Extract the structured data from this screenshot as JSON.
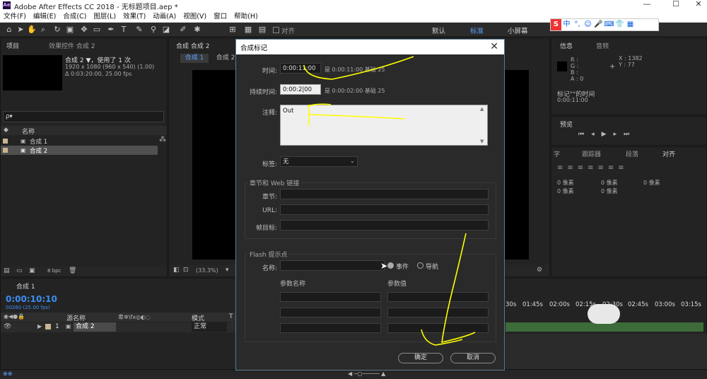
{
  "titlebar": {
    "logo": "Ae",
    "title": "Adobe After Effects CC 2018 - 无标题项目.aep *",
    "minimize": "—",
    "maximize": "☐",
    "close": "✕"
  },
  "menu": [
    "文件(F)",
    "编辑(E)",
    "合成(C)",
    "图层(L)",
    "效果(T)",
    "动画(A)",
    "视图(V)",
    "窗口",
    "帮助(H)"
  ],
  "toolbar": {
    "align_label": "对齐",
    "workspaces": [
      "默认",
      "标准",
      "小屏幕"
    ],
    "active_workspace": "标准"
  },
  "ime": [
    "S",
    "中",
    "°,",
    "☺",
    "🎤",
    "⌨",
    "👕",
    "▦"
  ],
  "project_panel": {
    "tab_project": "项目",
    "tab_effects": "效果控件 合成 2",
    "comp_name": "合成 2 ▼，使用了 1 次",
    "comp_size": "1920 x 1080 (960 x 540) (1.00)",
    "comp_duration": "Δ 0:03:20:00, 25.00 fps",
    "search_placeholder": "ρ▾",
    "col_name": "名称",
    "items": [
      "合成 1",
      "合成 2"
    ],
    "bpc": "8 bpc"
  },
  "comp_panel": {
    "tab_header": "合成 合成 2",
    "tabs": [
      "合成 1",
      "合成 2"
    ],
    "zoom": "(33.3%)"
  },
  "info_panel": {
    "tab_info": "信息",
    "tab_audio": "音频",
    "rgb": [
      "R :",
      "G :",
      "B :",
      "A : 0"
    ],
    "x": "X : 1382",
    "y": "Y : 77",
    "marker_name": "标记\"\"的时间",
    "marker_time": "0:00:11:00"
  },
  "preview_panel": {
    "title": "预览"
  },
  "char_panel": {
    "tabs": [
      "字",
      "跟踪器",
      "段落",
      "对齐"
    ],
    "values": [
      "0 像素",
      "0 像素",
      "0 像素",
      "0 像素",
      "0 像素"
    ]
  },
  "timeline": {
    "tab": "合成 1",
    "timecode": "0:00:10:10",
    "timecode_sub": "00260 (25.00 fps)",
    "col_source": "源名称",
    "col_mode": "模式",
    "col_t": "T",
    "layer_index": "1",
    "layer_name": "合成 2",
    "layer_mode": "正常",
    "ruler": [
      "30s",
      "01:45s",
      "02:00s",
      "02:15s",
      "02:30s",
      "02:45s",
      "03:00s",
      "03:15s"
    ]
  },
  "dialog": {
    "title": "合成标记",
    "close": "✕",
    "time_label": "时间:",
    "time_value": "0:00:11:00",
    "time_note": "是 0:00:11:00 基础 25",
    "duration_label": "持续时间:",
    "duration_value": "0:00:2|00",
    "duration_note": "是 0:00:02:00 基础 25",
    "comment_label": "注释:",
    "comment_value": "Out",
    "tag_label": "标签:",
    "tag_value": "无",
    "chapter_group": "章节和 Web 链接",
    "chapter_label": "章节:",
    "url_label": "URL:",
    "frame_target_label": "帧目标:",
    "flash_group": "Flash 提示点",
    "flash_name_label": "名称:",
    "event_label": "事件",
    "nav_label": "导航",
    "param_name_col": "参数名称",
    "param_value_col": "参数值",
    "ok": "确定",
    "cancel": "取消"
  },
  "colors": {
    "accent": "#5aa0ff",
    "timecode": "#3b8df0",
    "annotation": "#ffff00",
    "dialog_border": "#5a7a90"
  }
}
